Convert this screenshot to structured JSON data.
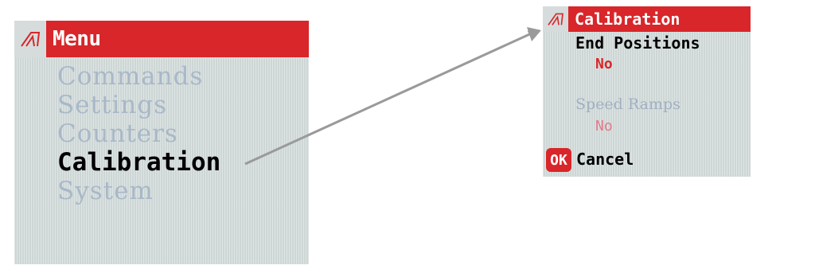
{
  "left_screen": {
    "title": "Menu",
    "items": [
      {
        "label": "Commands",
        "active": false
      },
      {
        "label": "Settings",
        "active": false
      },
      {
        "label": "Counters",
        "active": false
      },
      {
        "label": "Calibration",
        "active": true
      },
      {
        "label": "System",
        "active": false
      }
    ]
  },
  "right_screen": {
    "title": "Calibration",
    "fields": [
      {
        "label": "End Positions",
        "value": "No"
      },
      {
        "label": "Speed Ramps",
        "value": "No"
      }
    ],
    "ok_label": "OK",
    "cancel_label": "Cancel"
  },
  "colors": {
    "accent": "#d8262a",
    "screen_bg": "#d7e0df",
    "arrow": "#9a9a9a"
  }
}
